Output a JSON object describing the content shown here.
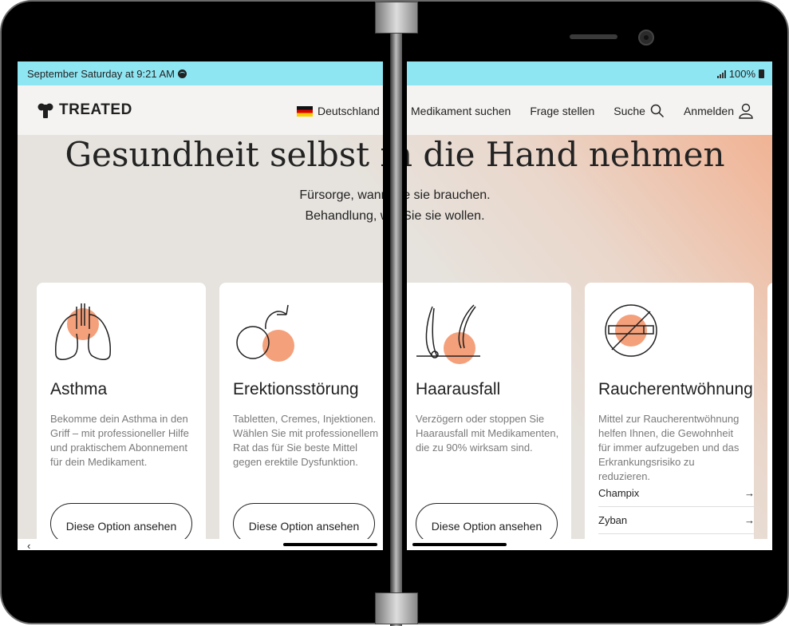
{
  "status_bar": {
    "time_text": "September Saturday at 9:21 AM",
    "battery": "100%"
  },
  "nav": {
    "logo": "TREATED",
    "country": "Deutschland",
    "find_medicine": "Medikament suchen",
    "ask_question": "Frage stellen",
    "search": "Suche",
    "login": "Anmelden"
  },
  "hero": {
    "title": "Gesundheit selbst in die Hand nehmen",
    "subtitle_line1": "Fürsorge, wann Sie sie brauchen.",
    "subtitle_line2": "Behandlung, wie Sie sie wollen."
  },
  "cards": [
    {
      "title": "Asthma",
      "description": "Bekomme dein Asthma in den Griff – mit professioneller Hilfe und praktischem Abonnement für dein Medikament.",
      "button": "Diese Option ansehen"
    },
    {
      "title": "Erektionsstörung",
      "description": "Tabletten, Cremes, Injektionen. Wählen Sie mit professionellem Rat das für Sie beste Mittel gegen erektile Dysfunktion.",
      "button": "Diese Option ansehen"
    },
    {
      "title": "Haarausfall",
      "description": "Verzögern oder stoppen Sie Haarausfall mit Medikamenten, die zu 90% wirksam sind.",
      "button": "Diese Option ansehen"
    },
    {
      "title": "Raucherentwöhnung",
      "description": "Mittel zur Raucherentwöhnung helfen Ihnen, die Gewohnheit für immer aufzugeben und das Erkrankungsrisiko zu reduzieren.",
      "medications": [
        "Champix",
        "Zyban"
      ]
    }
  ],
  "colors": {
    "accent": "#f4a07b",
    "status_bar": "#8fe6f3",
    "nav_bg": "#f4f3f1"
  }
}
